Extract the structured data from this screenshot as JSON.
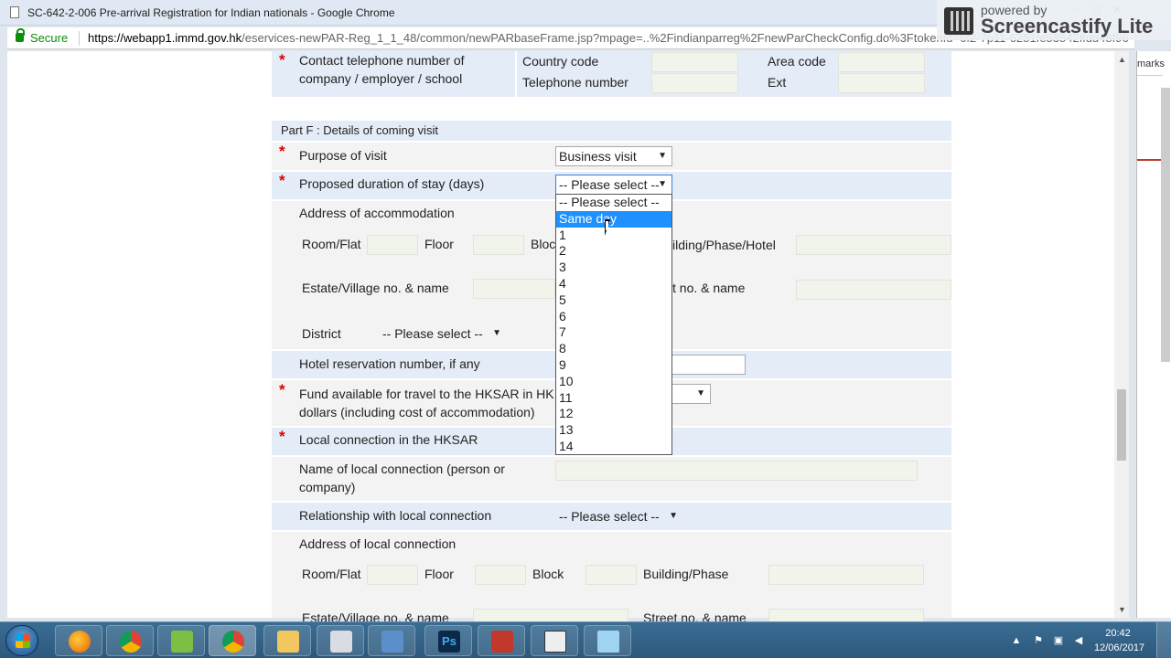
{
  "window": {
    "title": "SC-642-2-006 Pre-arrival Registration for Indian nationals - Google Chrome",
    "secure_label": "Secure",
    "url_host": "https://webapp1.immd.gov.hk",
    "url_path": "/eservices-newPAR-Reg_1_1_48/common/newPARbaseFrame.jsp?mpage=..%2Findianparreg%2FnewParCheckConfig.do%3FtokenId=6f2-7p11-6251fe53542ffdd48f96",
    "min_glyph": "–",
    "max_glyph": "◻",
    "close_glyph": "✕"
  },
  "overlay": {
    "powered_by": "powered by",
    "name": "Screencastify Lite"
  },
  "side_window": {
    "label": "marks"
  },
  "contact": {
    "label_line1": "Contact telephone number of",
    "label_line2": "company / employer / school",
    "country_code_label": "Country code",
    "area_code_label": "Area code",
    "telephone_label": "Telephone number",
    "ext_label": "Ext",
    "required_mark": "*"
  },
  "part_f": {
    "heading": "Part F : Details of coming visit",
    "purpose_label": "Purpose of visit",
    "purpose_value": "Business visit",
    "duration_label": "Proposed duration of stay (days)",
    "duration_value": "-- Please select --",
    "required_mark": "*",
    "duration_options": [
      "-- Please select --",
      "Same day",
      "1",
      "2",
      "3",
      "4",
      "5",
      "6",
      "7",
      "8",
      "9",
      "10",
      "11",
      "12",
      "13",
      "14"
    ],
    "duration_highlighted": "Same day",
    "accommodation_label": "Address of accommodation",
    "room_label": "Room/Flat",
    "floor_label": "Floor",
    "block_label": "Bloc",
    "building_label": "ilding/Phase/Hotel",
    "estate_label": "Estate/Village no. & name",
    "street_label": "t no. & name",
    "district_label": "District",
    "district_value": "-- Please select --",
    "hotel_label": "Hotel reservation number, if any",
    "fund_label_line1": "Fund available for travel to the HKSAR in HK",
    "fund_label_line2": "dollars (including cost of accommodation)",
    "local_connection_label": "Local connection in the HKSAR",
    "local_name_label_line1": "Name of local connection (person or",
    "local_name_label_line2": "company)",
    "relationship_label": "Relationship with local connection",
    "relationship_value": "-- Please select --",
    "local_address_label": "Address of local connection",
    "local_room_label": "Room/Flat",
    "local_floor_label": "Floor",
    "local_block_label": "Block",
    "local_building_label": "Building/Phase",
    "local_estate_label": "Estate/Village no. & name",
    "local_street_label": "Street no. & name"
  },
  "taskbar": {
    "time": "20:42",
    "date": "12/06/2017",
    "apps": [
      "firefox-icon",
      "chrome-icon",
      "greenshot-icon",
      "chrome-icon",
      "folder-icon",
      "calculator-icon",
      "screenshot-icon",
      "photoshop-icon",
      "tool-icon",
      "document-icon",
      "notes-icon"
    ]
  }
}
